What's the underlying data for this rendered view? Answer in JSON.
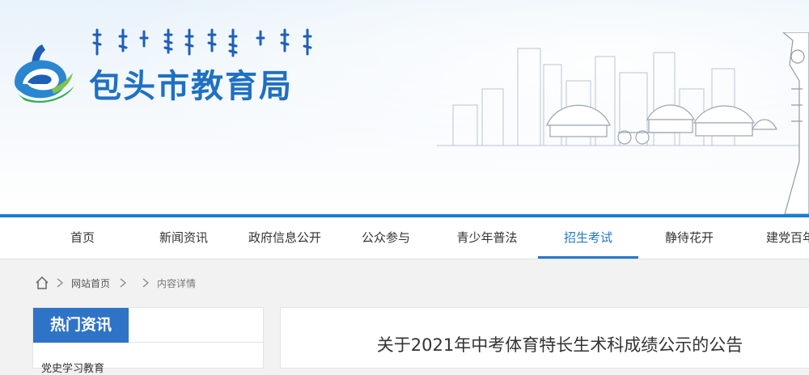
{
  "site": {
    "title": "包头市教育局",
    "mongolian_title": "ᠪᠤᠭᠤᠲᠤ ᠬᠤᠲᠠ ᠶᠢᠨ ᠪᠣᠯᠪᠠᠰᠤᠷᠠᠯ"
  },
  "nav": {
    "items": [
      {
        "label": "首页"
      },
      {
        "label": "新闻资讯"
      },
      {
        "label": "政府信息公开"
      },
      {
        "label": "公众参与"
      },
      {
        "label": "青少年普法"
      },
      {
        "label": "招生考试",
        "active": true
      },
      {
        "label": "静待花开"
      },
      {
        "label": "建党百年"
      }
    ]
  },
  "breadcrumb": {
    "home": "网站首页",
    "current": "内容详情"
  },
  "sidebar": {
    "heading": "热门资讯",
    "items": [
      "党史学习教育"
    ]
  },
  "article": {
    "title": "关于2021年中考体育特长生术科成绩公示的公告"
  },
  "colors": {
    "brand_blue": "#1f70c2",
    "accent_line": "#1a7ed1",
    "sidebar_head": "#2f73c7",
    "nav_active": "#2577c8"
  }
}
